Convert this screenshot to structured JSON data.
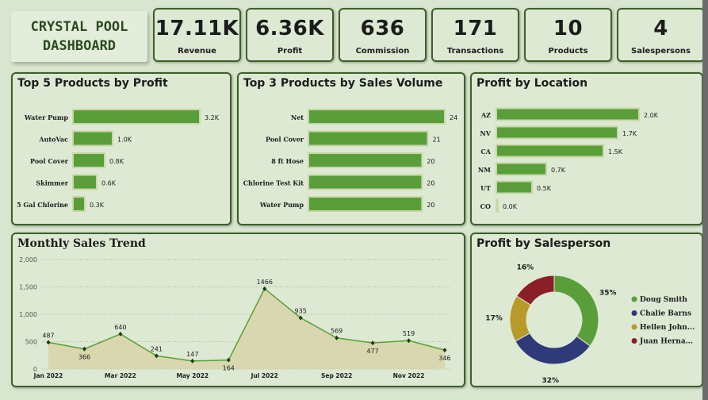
{
  "title": "CRYSTAL POOL\nDASHBOARD",
  "kpis": [
    {
      "value": "17.11K",
      "label": "Revenue"
    },
    {
      "value": "6.36K",
      "label": "Profit"
    },
    {
      "value": "636",
      "label": "Commission"
    },
    {
      "value": "171",
      "label": "Transactions"
    },
    {
      "value": "10",
      "label": "Products"
    },
    {
      "value": "4",
      "label": "Salespersons"
    }
  ],
  "colors": {
    "bar": "#5a9e3a",
    "bar_border": "#c8d8a8",
    "line": "#5a9e3a",
    "area": "#d8d4a8",
    "panel_border": "#3d5f2b"
  },
  "chart_data": [
    {
      "type": "bar",
      "title": "Top 5 Products by Profit",
      "orientation": "horizontal",
      "categories": [
        "Water Pump",
        "AutoVac",
        "Pool Cover",
        "Skimmer",
        "5 Gal Chlorine"
      ],
      "values": [
        3.2,
        1.0,
        0.8,
        0.6,
        0.3
      ],
      "value_labels": [
        "3.2K",
        "1.0K",
        "0.8K",
        "0.6K",
        "0.3K"
      ],
      "xlim": [
        0,
        3.2
      ]
    },
    {
      "type": "bar",
      "title": "Top 3 Products by Sales Volume",
      "orientation": "horizontal",
      "categories": [
        "Net",
        "Pool Cover",
        "8 ft Hose",
        "Chlorine Test Kit",
        "Water Pump"
      ],
      "values": [
        24,
        21,
        20,
        20,
        20
      ],
      "value_labels": [
        "24",
        "21",
        "20",
        "20",
        "20"
      ],
      "xlim": [
        0,
        24
      ]
    },
    {
      "type": "bar",
      "title": "Profit by Location",
      "orientation": "horizontal",
      "categories": [
        "AZ",
        "NV",
        "CA",
        "NM",
        "UT",
        "CO"
      ],
      "values": [
        2.0,
        1.7,
        1.5,
        0.7,
        0.5,
        0.0
      ],
      "value_labels": [
        "2.0K",
        "1.7K",
        "1.5K",
        "0.7K",
        "0.5K",
        "0.0K"
      ],
      "xlim": [
        0,
        2.0
      ]
    },
    {
      "type": "area",
      "title": "Monthly Sales Trend",
      "x": [
        "Jan 2022",
        "Feb 2022",
        "Mar 2022",
        "Apr 2022",
        "May 2022",
        "Jun 2022",
        "Jul 2022",
        "Aug 2022",
        "Sep 2022",
        "Oct 2022",
        "Nov 2022",
        "Dec 2022"
      ],
      "x_tick_labels": [
        "Jan 2022",
        "Mar 2022",
        "May 2022",
        "Jul 2022",
        "Sep 2022",
        "Nov 2022"
      ],
      "values": [
        487,
        366,
        640,
        241,
        147,
        164,
        1466,
        935,
        569,
        477,
        519,
        346
      ],
      "y_ticks": [
        "0",
        "500",
        "1,000",
        "1,500",
        "2,000"
      ],
      "ylim": [
        0,
        2000
      ],
      "grid": true
    },
    {
      "type": "pie",
      "title": "Profit by Salesperson",
      "donut": true,
      "categories": [
        "Doug Smith",
        "Chalie Barns",
        "Hellen John...",
        "Juan Herna..."
      ],
      "values": [
        35,
        32,
        17,
        16
      ],
      "value_labels": [
        "35%",
        "32%",
        "17%",
        "16%"
      ],
      "colors": [
        "#5a9e3a",
        "#2f3a78",
        "#b79a2a",
        "#8a1f28"
      ],
      "legend": "right"
    }
  ]
}
